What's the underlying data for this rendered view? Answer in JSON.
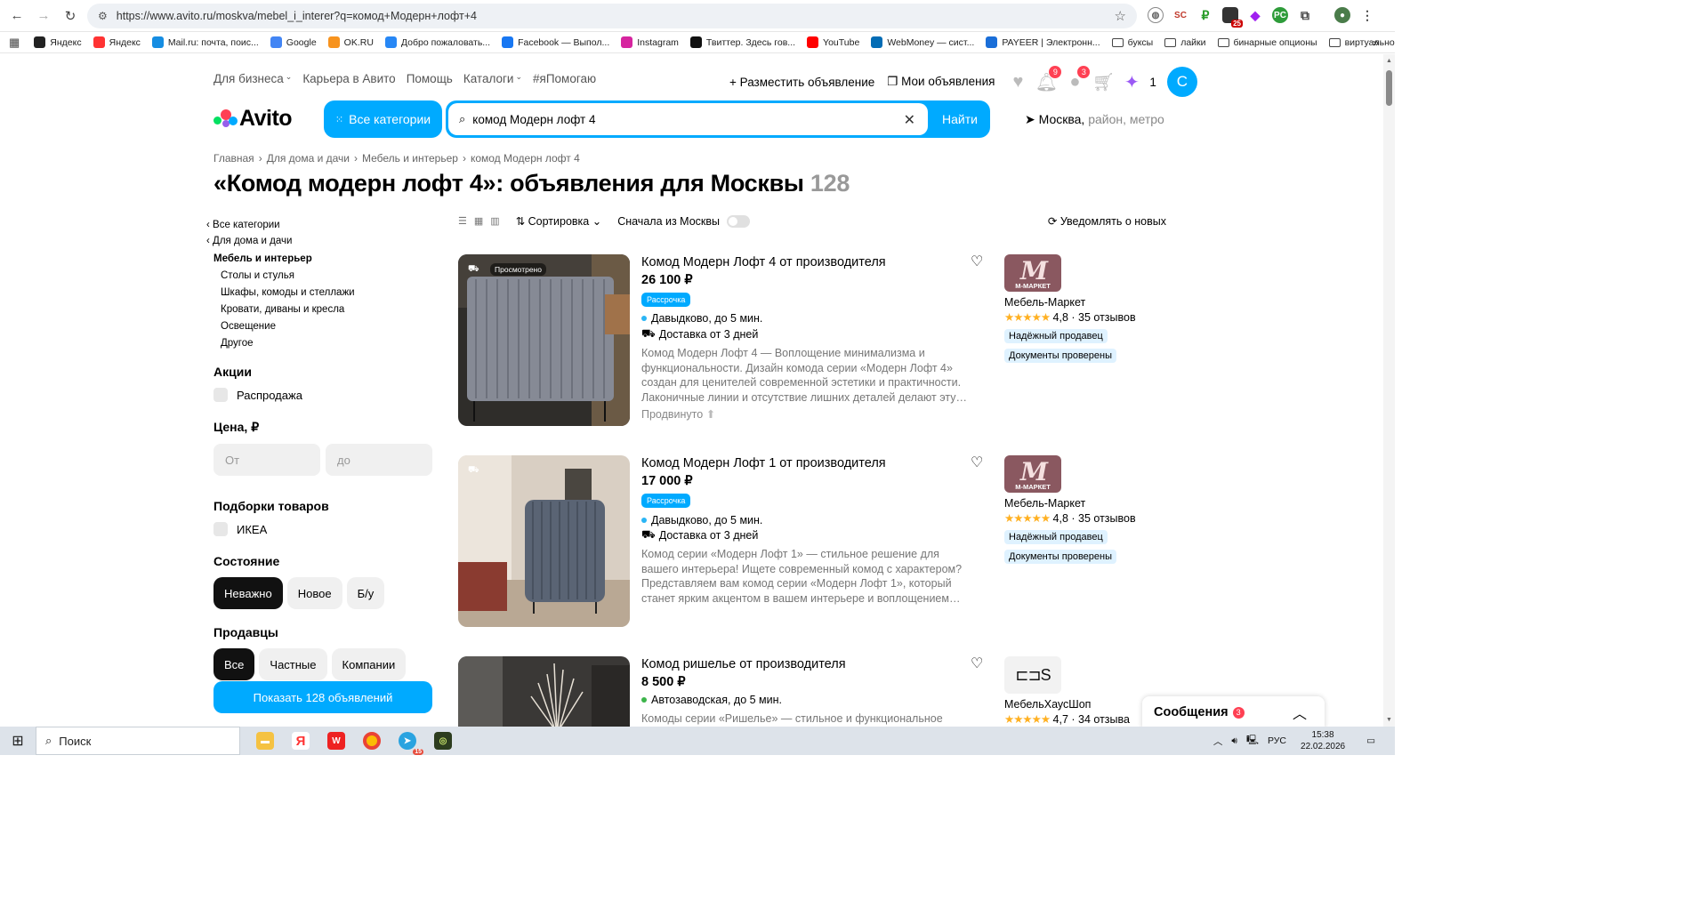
{
  "browser": {
    "url": "https://www.avito.ru/moskva/mebel_i_interer?q=комод+Модерн+лофт+4",
    "bookmarks": [
      {
        "label": "Яндекс",
        "color": "#222"
      },
      {
        "label": "Яндекс",
        "color": "#f33"
      },
      {
        "label": "Mail.ru: почта, поис...",
        "color": "#168de2"
      },
      {
        "label": "Google",
        "color": "#4285f4"
      },
      {
        "label": "OK.RU",
        "color": "#f7931e"
      },
      {
        "label": "Добро пожаловать...",
        "color": "#2787f5"
      },
      {
        "label": "Facebook — Выпол...",
        "color": "#1877f2"
      },
      {
        "label": "Instagram",
        "color": "#d6249f"
      },
      {
        "label": "Твиттер. Здесь гов...",
        "color": "#111"
      },
      {
        "label": "YouTube",
        "color": "#f00"
      },
      {
        "label": "WebMoney — сист...",
        "color": "#036cb5"
      },
      {
        "label": "PAYEER | Электронн...",
        "color": "#1a6ed8"
      }
    ],
    "folders": [
      "буксы",
      "лайки",
      "бинарные опционы",
      "виртуально"
    ]
  },
  "header": {
    "nav": [
      "Для бизнеса",
      "Карьера в Авито",
      "Помощь",
      "Каталоги",
      "#яПомогаю"
    ],
    "post_ad": "Разместить объявление",
    "my_ads": "Мои объявления",
    "notif_count": "9",
    "msg_count": "3",
    "promo_count": "1",
    "avatar_letter": "C",
    "logo": "Avito",
    "all_categories": "Все категории",
    "search_value": "комод Модерн лофт 4",
    "search_button": "Найти",
    "city": "Москва,",
    "city_hint": " район, метро"
  },
  "breadcrumbs": [
    "Главная",
    "›",
    "Для дома и дачи",
    "›",
    "Мебель и интерьер",
    "›",
    "комод Модерн лофт 4"
  ],
  "page_title": "«Комод модерн лофт 4»: объявления для Москвы",
  "result_count": "128",
  "sidebar": {
    "back1": "‹ Все категории",
    "back2": "‹ Для дома и дачи",
    "current": "Мебель и интерьер",
    "subs": [
      "Столы и стулья",
      "Шкафы, комоды и стеллажи",
      "Кровати, диваны и кресла",
      "Освещение",
      "Другое"
    ],
    "promo_title": "Акции",
    "promo_item": "Распродажа",
    "price_title": "Цена, ₽",
    "price_from": "От",
    "price_to": "до",
    "collections_title": "Подборки товаров",
    "collections_item": "ИКЕА",
    "condition_title": "Состояние",
    "conditions": [
      "Неважно",
      "Новое",
      "Б/у"
    ],
    "sellers_title": "Продавцы",
    "sellers": [
      "Все",
      "Частные",
      "Компании"
    ],
    "show_button": "Показать 128 объявлений"
  },
  "toolbar": {
    "sort": "Сортировка",
    "moscow_first": "Сначала из Москвы",
    "notify": "Уведомлять о новых"
  },
  "listings": [
    {
      "title": "Комод Модерн Лофт 4 от производителя",
      "price": "26 100 ₽",
      "badge": "Рассрочка",
      "seen": "Просмотрено",
      "location": "Давыдково, до 5 мин.",
      "delivery": "Доставка от 3 дней",
      "desc": "Комод Модерн Лофт 4 — Воплощение минимализма и функциональности. Дизайн комода серии «Модерн Лофт 4» создан для ценителей современной эстетики и практичности. Лаконичные линии и отсутствие лишних деталей делают эту…",
      "promoted": "Продвинуто",
      "seller_name": "Мебель-Маркет",
      "seller_logo": "M-МАРКЕТ",
      "rating": "4,8",
      "reviews": "· 35 отзывов",
      "tags": [
        "Надёжный продавец",
        "Документы проверены"
      ]
    },
    {
      "title": "Комод Модерн Лофт 1 от производителя",
      "price": "17 000 ₽",
      "badge": "Рассрочка",
      "location": "Давыдково, до 5 мин.",
      "delivery": "Доставка от 3 дней",
      "desc": "Комод серии «Модерн Лофт 1» — стильное решение для вашего интерьера! Ищете современный комод с характером? Представляем вам комод серии «Модерн Лофт 1», который станет ярким акцентом в вашем интерьере и воплощением…",
      "seller_name": "Мебель-Маркет",
      "seller_logo": "M-МАРКЕТ",
      "rating": "4,8",
      "reviews": "· 35 отзывов",
      "tags": [
        "Надёжный продавец",
        "Документы проверены"
      ]
    },
    {
      "title": "Комод ришелье от производителя",
      "price": "8 500 ₽",
      "location": "Автозаводская, до 5 мин.",
      "desc": "Комоды серии «Ришелье» — стильное и функциональное",
      "seller_name": "МебельХаусШоп",
      "rating": "4,7",
      "reviews": "· 34 отзыва"
    }
  ],
  "messages": {
    "label": "Сообщения",
    "count": "3"
  },
  "taskbar": {
    "search": "Поиск",
    "lang": "РУС",
    "time": "15:38",
    "date": "22.02.2026",
    "telegram_badge": "15"
  }
}
